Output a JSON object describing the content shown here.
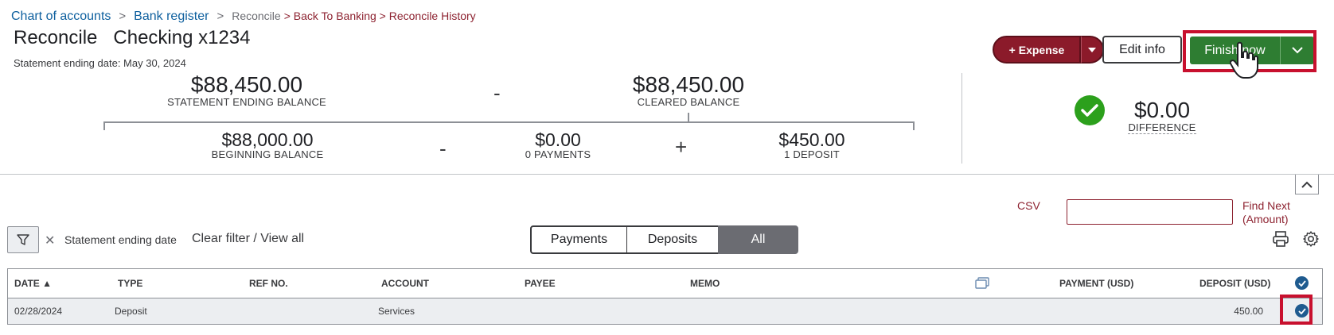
{
  "breadcrumb": {
    "chart_of_accounts": "Chart of accounts",
    "sep1": ">",
    "bank_register": "Bank register",
    "sep2": ">",
    "reconcile": "Reconcile",
    "back_trail": "> Back To Banking > Reconcile History"
  },
  "header": {
    "title": "Reconcile",
    "account": "Checking x1234",
    "statement_date": "Statement ending date: May 30, 2024"
  },
  "toolbar": {
    "expense_label": "+ Expense",
    "edit_info_label": "Edit info",
    "finish_label": "Finish now"
  },
  "summary": {
    "statement_ending_balance": {
      "amount": "$88,450.00",
      "label": "STATEMENT ENDING BALANCE"
    },
    "minus1": "-",
    "cleared_balance": {
      "amount": "$88,450.00",
      "label": "CLEARED BALANCE"
    },
    "beginning_balance": {
      "amount": "$88,000.00",
      "label": "BEGINNING BALANCE"
    },
    "minus2": "-",
    "payments": {
      "amount": "$0.00",
      "label": "0 PAYMENTS"
    },
    "plus": "+",
    "deposits": {
      "amount": "$450.00",
      "label": "1 DEPOSIT"
    },
    "difference": {
      "amount": "$0.00",
      "label": "DIFFERENCE"
    }
  },
  "search": {
    "csv_label": "CSV",
    "find_value": "",
    "find_next_label_1": "Find Next",
    "find_next_label_2": "(Amount)"
  },
  "filters": {
    "chip_label": "Statement ending date",
    "clear_label": "Clear filter / View all",
    "tabs": [
      "Payments",
      "Deposits",
      "All"
    ],
    "selected_tab": "All"
  },
  "table": {
    "columns": [
      "DATE ▲",
      "TYPE",
      "REF NO.",
      "ACCOUNT",
      "PAYEE",
      "MEMO",
      "PAYMENT (USD)",
      "DEPOSIT (USD)"
    ],
    "rows": [
      {
        "date": "02/28/2024",
        "type": "Deposit",
        "ref_no": "",
        "account": "Services",
        "payee": "",
        "memo": "",
        "payment": "",
        "deposit": "450.00",
        "cleared": true
      }
    ]
  },
  "colors": {
    "brand_link": "#0d5f9e",
    "expense_button": "#8b1a2a",
    "finish_button": "#2e7d32",
    "success": "#2ca01c",
    "highlight_outline": "#c8102e"
  },
  "icons": [
    "filter-icon",
    "close-icon",
    "print-icon",
    "gear-icon",
    "chevron-up-icon",
    "checkmark-icon",
    "columns-icon",
    "hand-cursor-icon"
  ]
}
